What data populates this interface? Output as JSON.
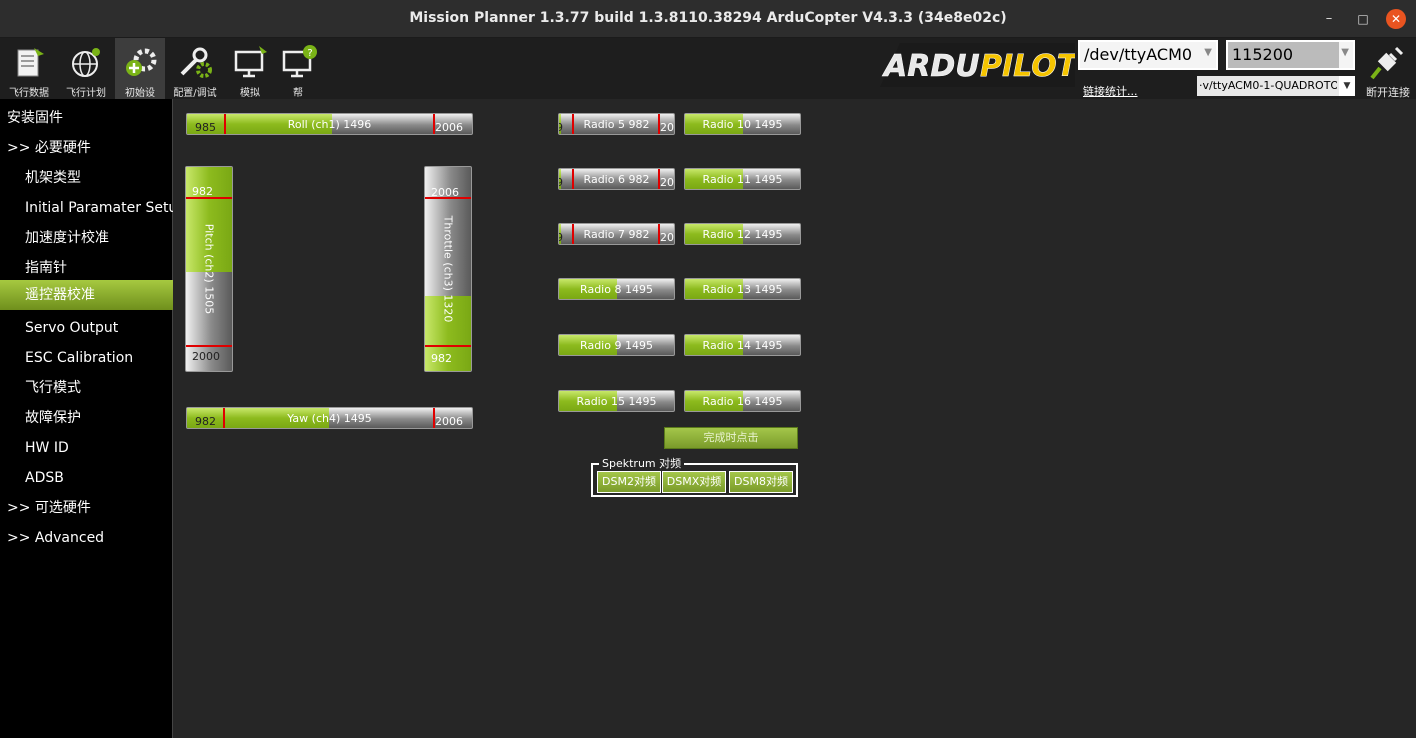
{
  "window": {
    "title": "Mission Planner 1.3.77 build 1.3.8110.38294 ArduCopter V4.3.3 (34e8e02c)",
    "min_glyph": "–",
    "max_glyph": "□",
    "close_glyph": "✕"
  },
  "toolbar": {
    "items": [
      {
        "label": "飞行数据",
        "icon": "flight-data-icon"
      },
      {
        "label": "飞行计划",
        "icon": "flight-plan-icon"
      },
      {
        "label": "初始设",
        "icon": "initial-setup-icon"
      },
      {
        "label": "配置/调试",
        "icon": "config-tuning-icon"
      },
      {
        "label": "模拟",
        "icon": "simulation-icon"
      },
      {
        "label": "帮",
        "icon": "help-icon"
      }
    ],
    "active_index": 2,
    "logo_text_1": "ARDU",
    "logo_text_2": "PILOT",
    "port_value": "/dev/ttyACM0",
    "baud_value": "115200",
    "stats_link": "链接统计...",
    "profile_value": "·v/ttyACM0-1-QUADROTOR",
    "connect_label": "断开连接"
  },
  "sidebar": {
    "items": [
      {
        "label": "安装固件",
        "level": 0
      },
      {
        "label": ">> 必要硬件",
        "level": 0
      },
      {
        "label": "机架类型",
        "level": 1
      },
      {
        "label": "Initial Paramater Setup",
        "level": 1
      },
      {
        "label": "加速度计校准",
        "level": 1
      },
      {
        "label": "指南针",
        "level": 1
      },
      {
        "label": "遥控器校准",
        "level": 1,
        "active": true
      },
      {
        "label": "Servo Output",
        "level": 1
      },
      {
        "label": "ESC Calibration",
        "level": 1
      },
      {
        "label": "飞行模式",
        "level": 1
      },
      {
        "label": "故障保护",
        "level": 1
      },
      {
        "label": "HW ID",
        "level": 1
      },
      {
        "label": "ADSB",
        "level": 1
      },
      {
        "label": ">> 可选硬件",
        "level": 0
      },
      {
        "label": ">> Advanced",
        "level": 0
      }
    ]
  },
  "radio": {
    "roll": {
      "label": "Roll (ch1)",
      "value": "1496",
      "min": "985",
      "max": "2006"
    },
    "pitch": {
      "label": "Pitch (ch2)",
      "value": "1505",
      "min": "982",
      "max": "2000"
    },
    "throttle": {
      "label": "Throttle (ch3)",
      "value": "1320",
      "min": "982",
      "max": "2006"
    },
    "yaw": {
      "label": "Yaw (ch4)",
      "value": "1495",
      "min": "982",
      "max": "2006"
    },
    "channels": [
      {
        "label": "Radio 5",
        "value": "982",
        "edge_left": "9",
        "edge_right": "200"
      },
      {
        "label": "Radio 10",
        "value": "1495"
      },
      {
        "label": "Radio 6",
        "value": "982",
        "edge_left": "9",
        "edge_right": "200"
      },
      {
        "label": "Radio 11",
        "value": "1495"
      },
      {
        "label": "Radio 7",
        "value": "982",
        "edge_left": "9",
        "edge_right": "200"
      },
      {
        "label": "Radio 12",
        "value": "1495"
      },
      {
        "label": "Radio 8",
        "value": "1495"
      },
      {
        "label": "Radio 13",
        "value": "1495"
      },
      {
        "label": "Radio 9",
        "value": "1495"
      },
      {
        "label": "Radio 14",
        "value": "1495"
      },
      {
        "label": "Radio 15",
        "value": "1495"
      },
      {
        "label": "Radio 16",
        "value": "1495"
      }
    ],
    "done_button": "完成时点击",
    "spektrum": {
      "legend": "Spektrum 对频",
      "buttons": [
        "DSM2对频",
        "DSMX对频",
        "DSM8对频"
      ]
    }
  },
  "colors": {
    "accent_green": "#8dbb1e",
    "marker_red": "#e00000",
    "close_orange": "#e95420"
  }
}
